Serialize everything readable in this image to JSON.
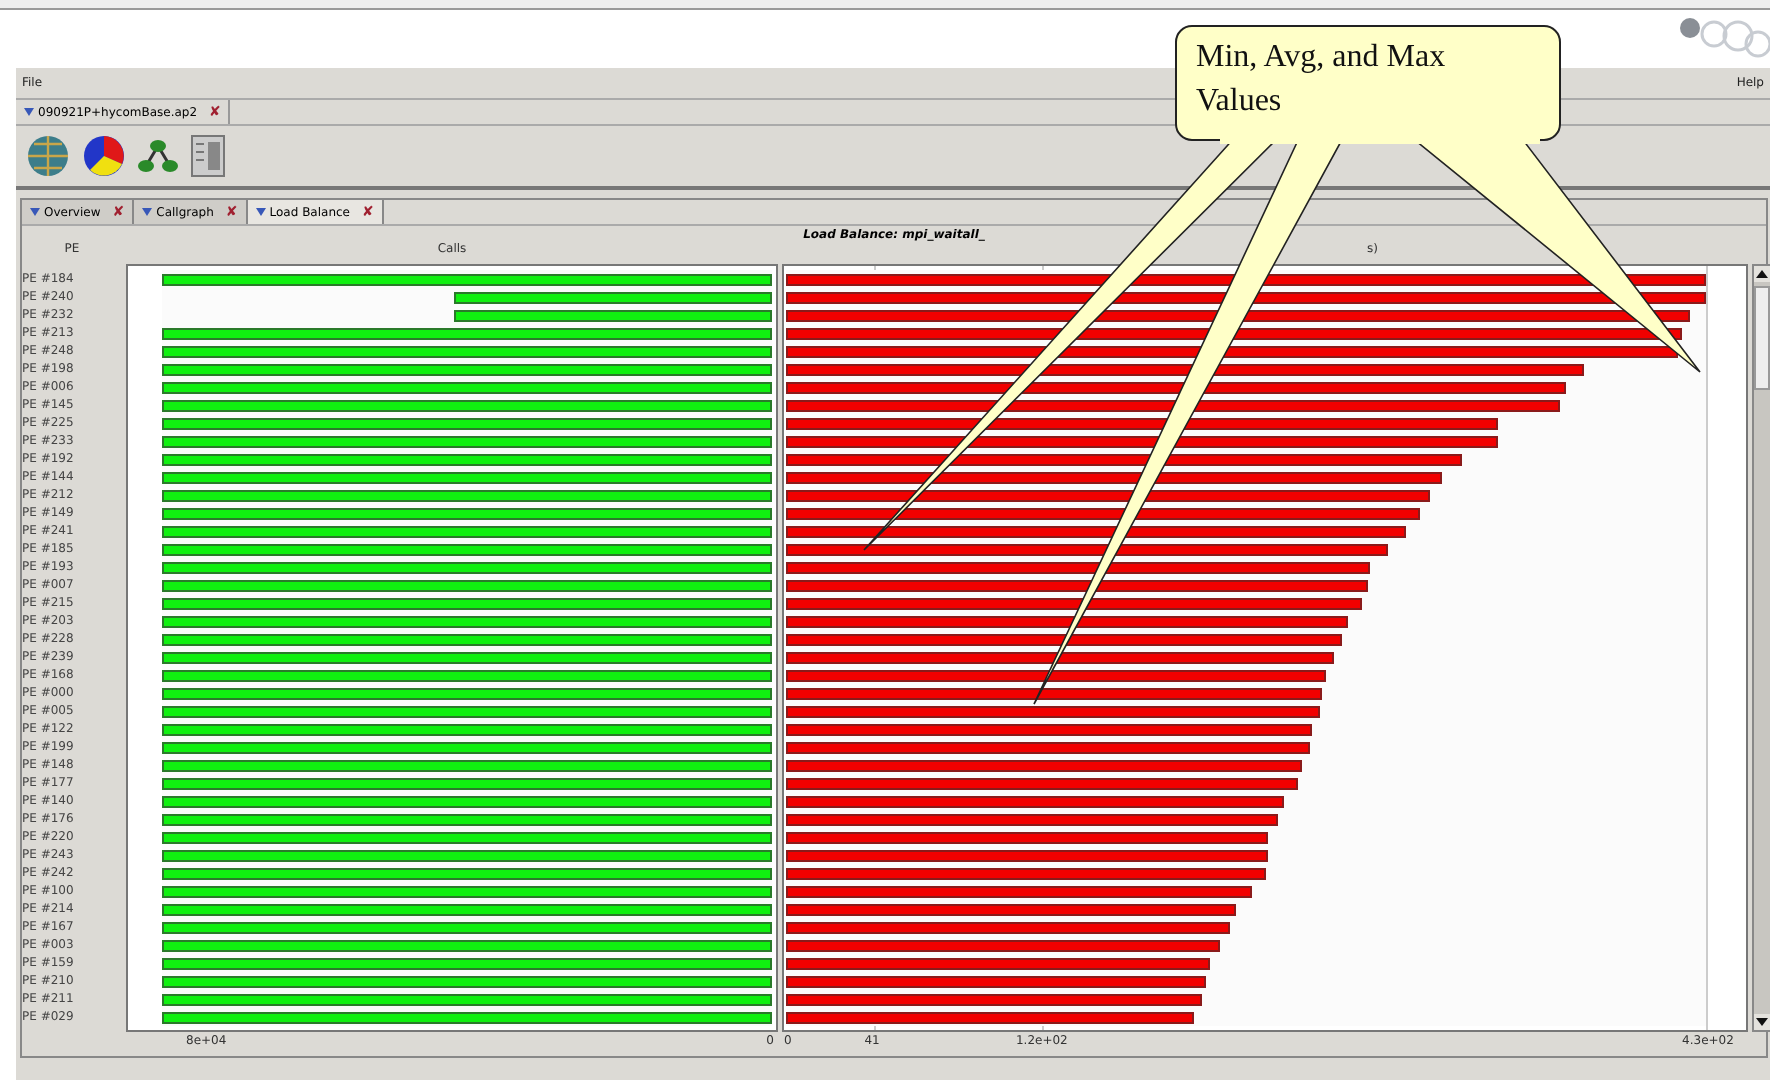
{
  "menu": [
    "File",
    "Help"
  ],
  "file_tab": {
    "label": "090921P+hycomBase.ap2",
    "close": "✘"
  },
  "view_tabs": [
    {
      "label": "Overview",
      "close": "✘",
      "selected": false
    },
    {
      "label": "Callgraph",
      "close": "✘",
      "selected": false
    },
    {
      "label": "Load Balance",
      "close": "✘",
      "selected": true
    }
  ],
  "chart_title": "Load Balance: mpi_waitall_",
  "headers": {
    "pe": "PE",
    "calls": "Calls",
    "time": "s)"
  },
  "rows": [
    {
      "pe": "PE #184",
      "calls": {
        "level": 1
      },
      "time": {
        "level": 1
      }
    },
    {
      "pe": "PE #240",
      "calls": {
        "level": 0.52
      },
      "time": {
        "level": 1
      }
    },
    {
      "pe": "PE #232",
      "calls": {
        "level": 0.52
      },
      "time": {
        "level": 0.983
      }
    },
    {
      "pe": "PE #213",
      "calls": {
        "level": 1
      },
      "time": {
        "level": 0.974
      }
    },
    {
      "pe": "PE #248",
      "calls": {
        "level": 1
      },
      "time": {
        "level": 0.97
      }
    },
    {
      "pe": "PE #198",
      "calls": {
        "level": 1
      },
      "time": {
        "level": 0.868
      }
    },
    {
      "pe": "PE #006",
      "calls": {
        "level": 1
      },
      "time": {
        "level": 0.848
      }
    },
    {
      "pe": "PE #145",
      "calls": {
        "level": 1
      },
      "time": {
        "level": 0.842
      }
    },
    {
      "pe": "PE #225",
      "calls": {
        "level": 1
      },
      "time": {
        "level": 0.773
      }
    },
    {
      "pe": "PE #233",
      "calls": {
        "level": 1
      },
      "time": {
        "level": 0.773
      }
    },
    {
      "pe": "PE #192",
      "calls": {
        "level": 1
      },
      "time": {
        "level": 0.734
      }
    },
    {
      "pe": "PE #144",
      "calls": {
        "level": 1
      },
      "time": {
        "level": 0.714
      }
    },
    {
      "pe": "PE #212",
      "calls": {
        "level": 1
      },
      "time": {
        "level": 0.701
      }
    },
    {
      "pe": "PE #149",
      "calls": {
        "level": 1
      },
      "time": {
        "level": 0.69
      }
    },
    {
      "pe": "PE #241",
      "calls": {
        "level": 1
      },
      "time": {
        "level": 0.673
      }
    },
    {
      "pe": "PE #185",
      "calls": {
        "level": 1
      },
      "time": {
        "level": 0.654
      }
    },
    {
      "pe": "PE #193",
      "calls": {
        "level": 1
      },
      "time": {
        "level": 0.634
      }
    },
    {
      "pe": "PE #007",
      "calls": {
        "level": 1
      },
      "time": {
        "level": 0.632
      }
    },
    {
      "pe": "PE #215",
      "calls": {
        "level": 1
      },
      "time": {
        "level": 0.627
      }
    },
    {
      "pe": "PE #203",
      "calls": {
        "level": 1
      },
      "time": {
        "level": 0.61
      }
    },
    {
      "pe": "PE #228",
      "calls": {
        "level": 1
      },
      "time": {
        "level": 0.604
      }
    },
    {
      "pe": "PE #239",
      "calls": {
        "level": 1
      },
      "time": {
        "level": 0.595
      }
    },
    {
      "pe": "PE #168",
      "calls": {
        "level": 1
      },
      "time": {
        "level": 0.588
      }
    },
    {
      "pe": "PE #000",
      "calls": {
        "level": 1
      },
      "time": {
        "level": 0.582
      }
    },
    {
      "pe": "PE #005",
      "calls": {
        "level": 1
      },
      "time": {
        "level": 0.58
      }
    },
    {
      "pe": "PE #122",
      "calls": {
        "level": 1
      },
      "time": {
        "level": 0.571
      }
    },
    {
      "pe": "PE #199",
      "calls": {
        "level": 1
      },
      "time": {
        "level": 0.569
      }
    },
    {
      "pe": "PE #148",
      "calls": {
        "level": 1
      },
      "time": {
        "level": 0.56
      }
    },
    {
      "pe": "PE #177",
      "calls": {
        "level": 1
      },
      "time": {
        "level": 0.556
      }
    },
    {
      "pe": "PE #140",
      "calls": {
        "level": 1
      },
      "time": {
        "level": 0.541
      }
    },
    {
      "pe": "PE #176",
      "calls": {
        "level": 1
      },
      "time": {
        "level": 0.535
      }
    },
    {
      "pe": "PE #220",
      "calls": {
        "level": 1
      },
      "time": {
        "level": 0.524
      }
    },
    {
      "pe": "PE #243",
      "calls": {
        "level": 1
      },
      "time": {
        "level": 0.524
      }
    },
    {
      "pe": "PE #242",
      "calls": {
        "level": 1
      },
      "time": {
        "level": 0.522
      }
    },
    {
      "pe": "PE #100",
      "calls": {
        "level": 1
      },
      "time": {
        "level": 0.506
      }
    },
    {
      "pe": "PE #214",
      "calls": {
        "level": 1
      },
      "time": {
        "level": 0.489
      }
    },
    {
      "pe": "PE #167",
      "calls": {
        "level": 1
      },
      "time": {
        "level": 0.483
      }
    },
    {
      "pe": "PE #003",
      "calls": {
        "level": 1
      },
      "time": {
        "level": 0.472
      }
    },
    {
      "pe": "PE #159",
      "calls": {
        "level": 1
      },
      "time": {
        "level": 0.461
      }
    },
    {
      "pe": "PE #210",
      "calls": {
        "level": 1
      },
      "time": {
        "level": 0.457
      }
    },
    {
      "pe": "PE #211",
      "calls": {
        "level": 1
      },
      "time": {
        "level": 0.452
      }
    },
    {
      "pe": "PE #029",
      "calls": {
        "level": 1
      },
      "time": {
        "level": 0.444
      }
    }
  ],
  "calls_axis": [
    "8e+04",
    "0"
  ],
  "time_axis": [
    "0",
    "41",
    "1.2e+02",
    "4.3e+02"
  ],
  "callout": "Min, Avg, and Max Values"
}
